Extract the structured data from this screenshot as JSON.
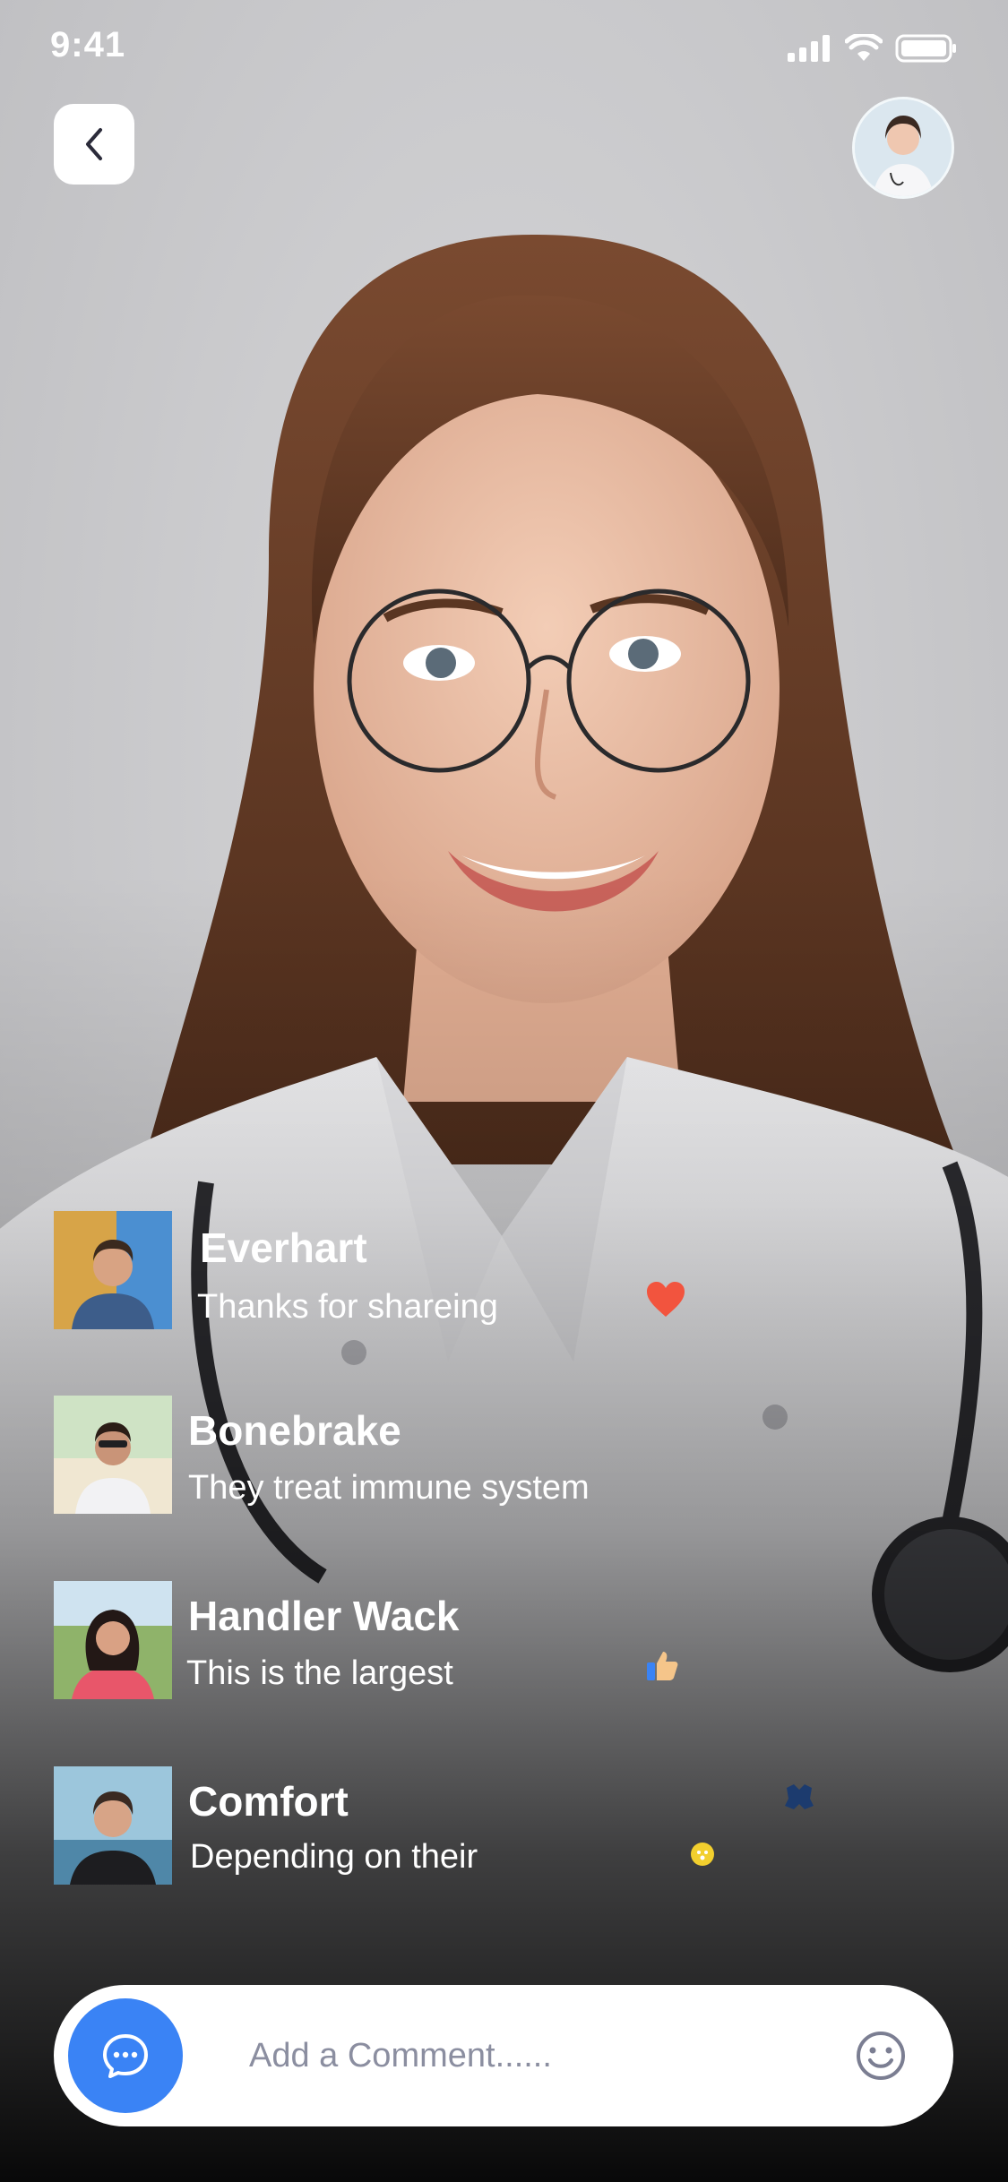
{
  "status_bar": {
    "time": "9:41"
  },
  "header": {
    "back_icon": "chevron-left-icon",
    "profile_avatar": "doctor-avatar"
  },
  "comments": [
    {
      "name": "Everhart",
      "text": "Thanks for shareing"
    },
    {
      "name": "Bonebrake",
      "text": "They treat immune system"
    },
    {
      "name": "Handler Wack",
      "text": "This is the largest"
    },
    {
      "name": "Comfort",
      "text": "Depending on their"
    }
  ],
  "reactions": [
    "heart-icon",
    "thumbs-up-icon",
    "like-icon",
    "emoji-icon"
  ],
  "comment_bar": {
    "placeholder": "Add a Comment......",
    "chat_icon": "chat-bubble-icon",
    "emoji_icon": "smiley-icon"
  },
  "colors": {
    "accent": "#3A83F5",
    "heart": "#F2543E",
    "background": "#C9C9CB"
  }
}
